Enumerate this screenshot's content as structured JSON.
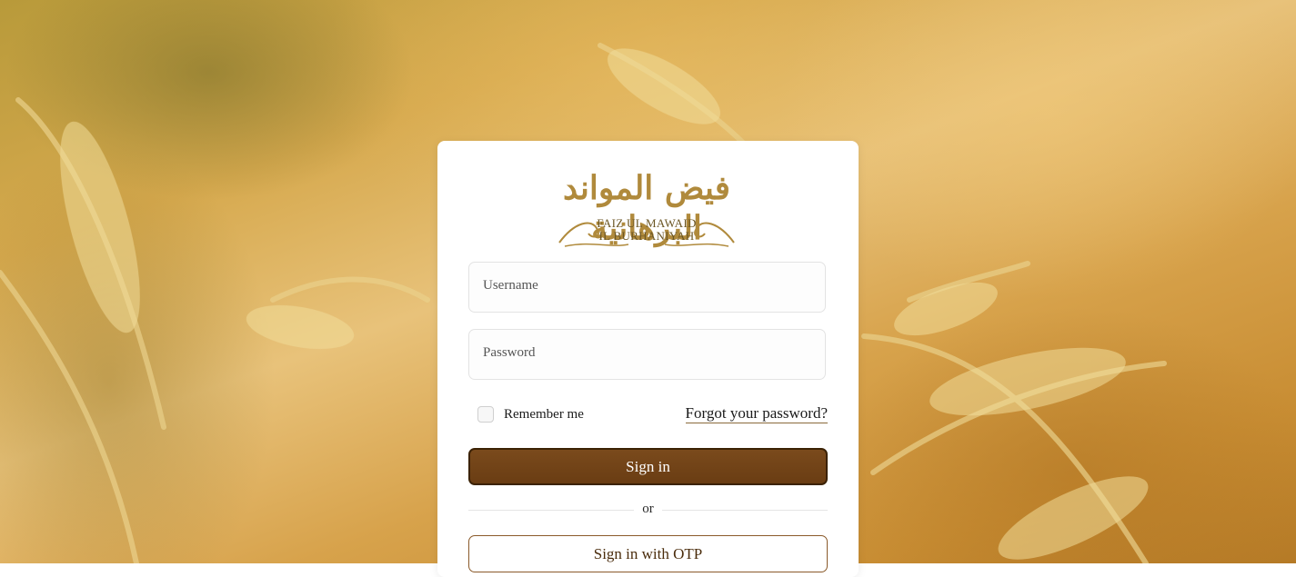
{
  "brand": {
    "arabic_name": "فيض المواند البرهانية",
    "name_line1": "FAIZ UL MAWAID",
    "name_line2": "IL BURHANIYAH"
  },
  "form": {
    "username_placeholder": "Username",
    "password_placeholder": "Password",
    "remember_label": "Remember me",
    "remember_checked": false,
    "forgot_label": "Forgot your password?",
    "signin_label": "Sign in",
    "divider_label": "or",
    "otp_label": "Sign in with OTP"
  },
  "colors": {
    "primary": "#6a3d13",
    "primary_border": "#3b2205",
    "logo_gold": "#b08a3c",
    "card_bg": "#ffffff"
  }
}
